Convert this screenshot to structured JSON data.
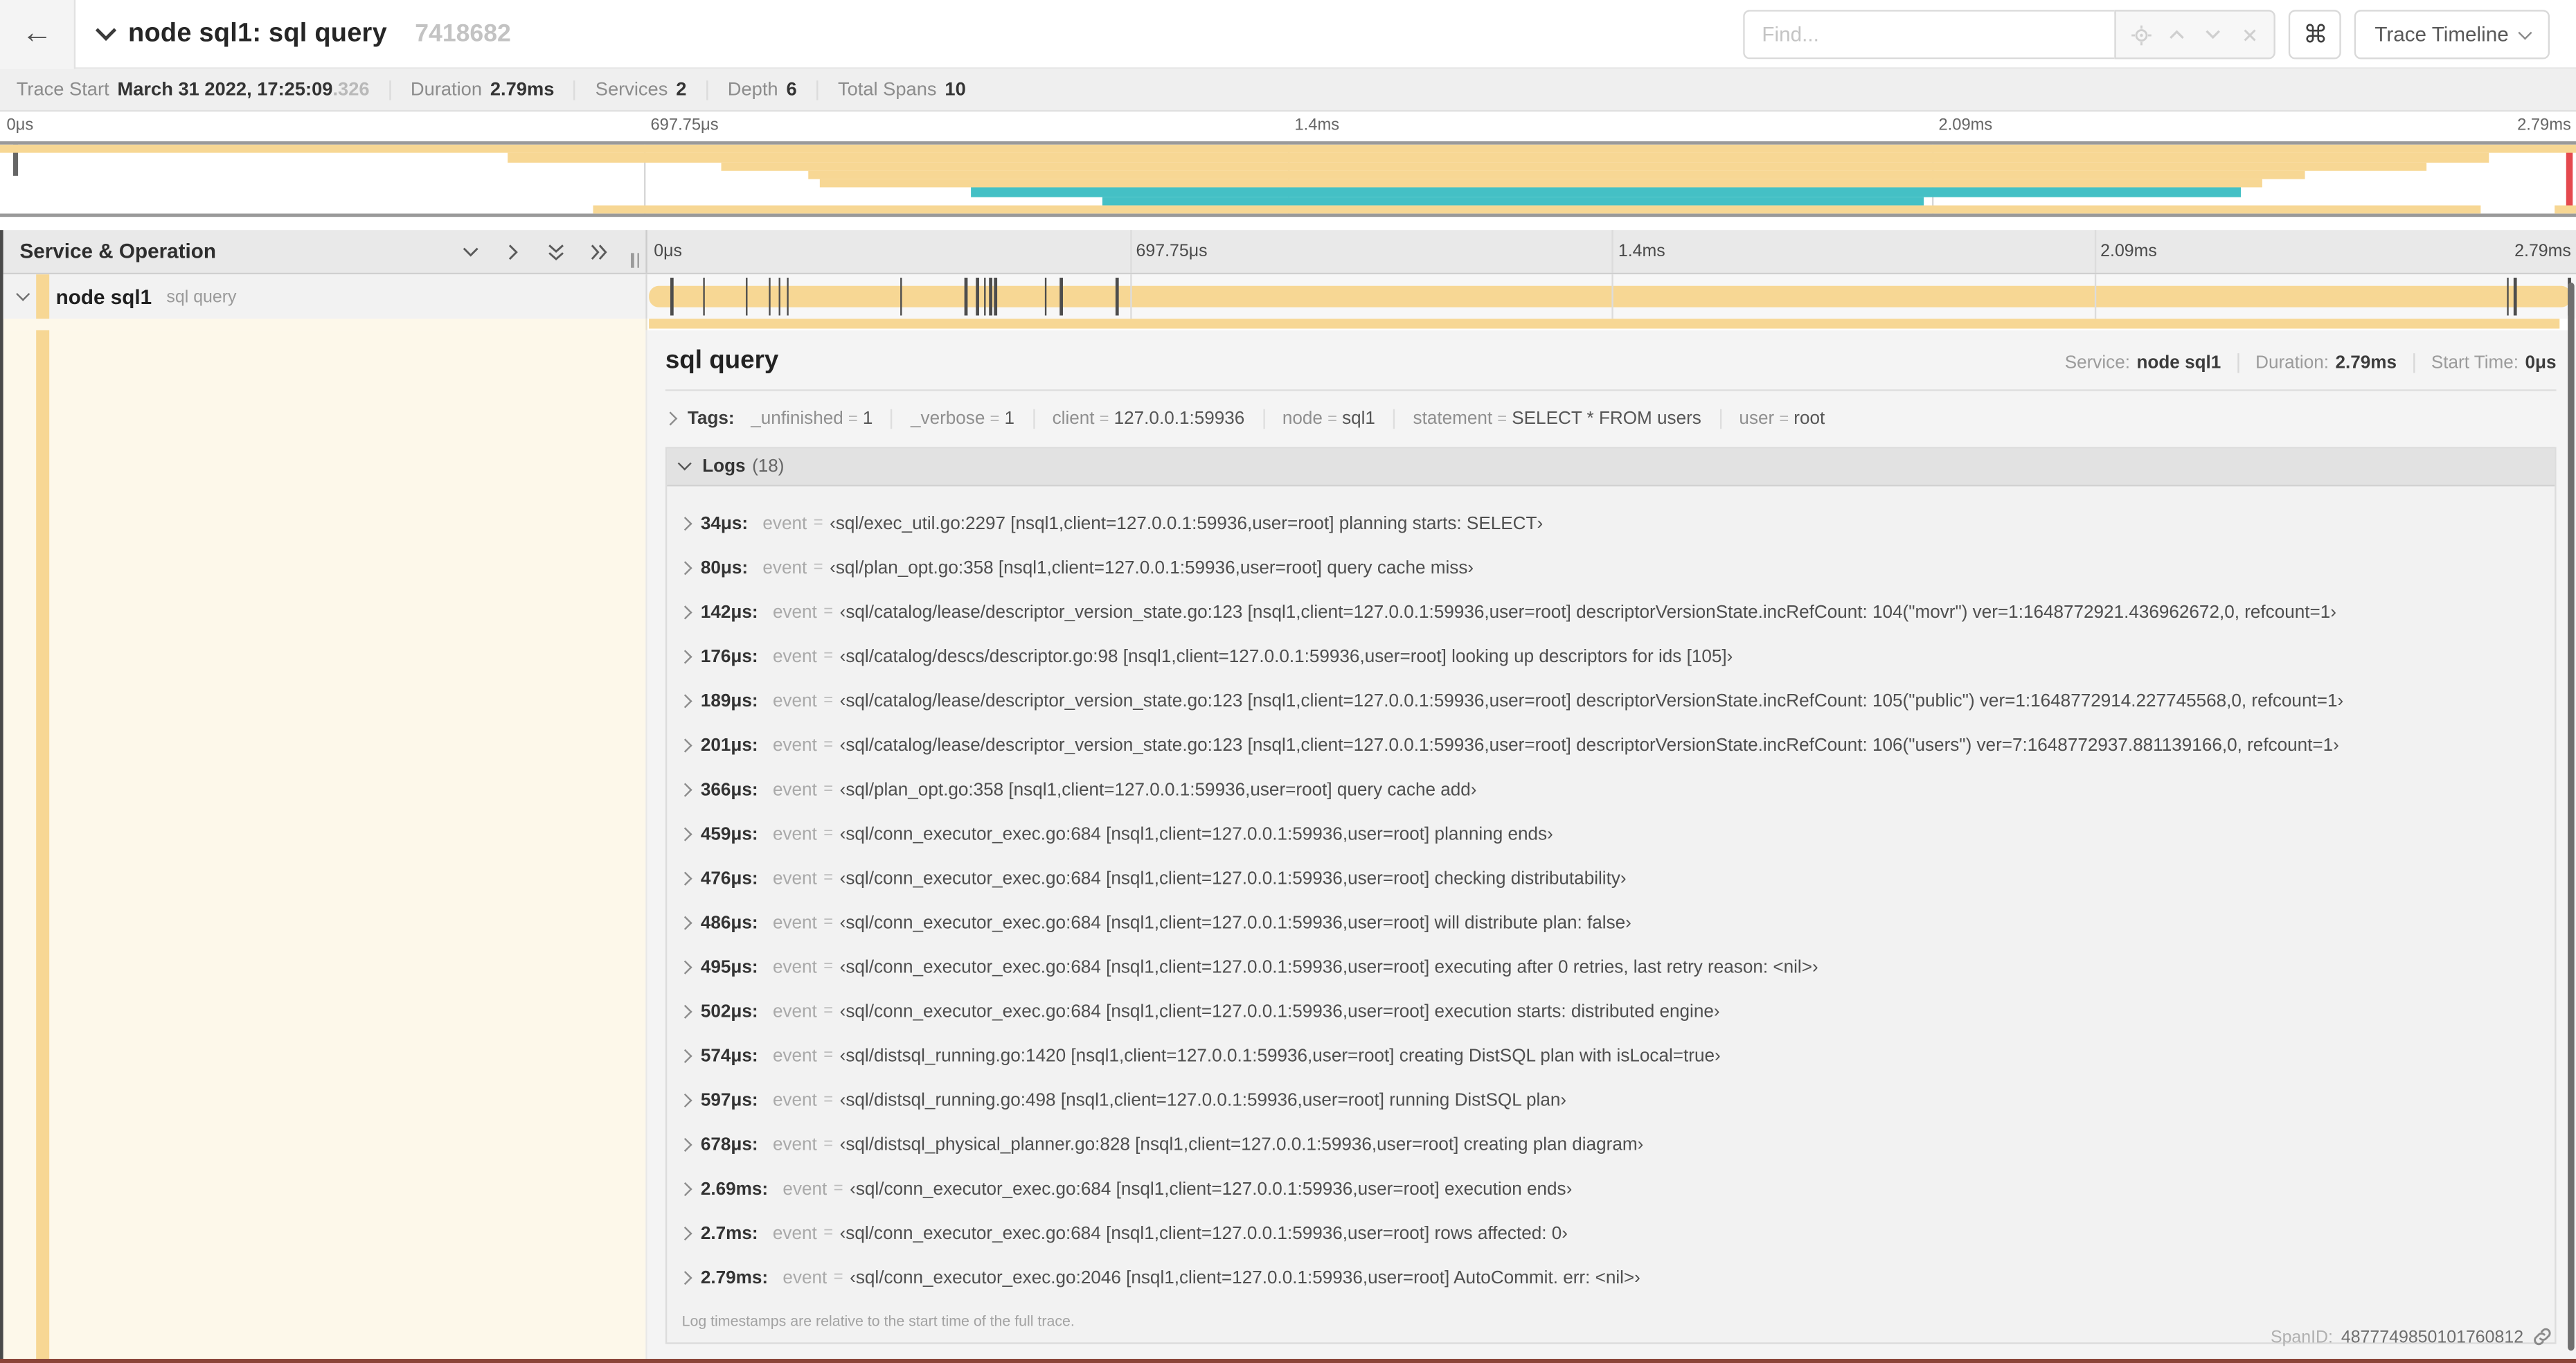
{
  "header": {
    "title": "node sql1: sql query",
    "trace_id": "7418682",
    "find_placeholder": "Find...",
    "view_selector": "Trace Timeline"
  },
  "trace_info": {
    "items": [
      {
        "label": "Trace Start",
        "value": "March 31 2022, 17:25:09",
        "value_muted": ".326"
      },
      {
        "label": "Duration",
        "value": "2.79ms"
      },
      {
        "label": "Services",
        "value": "2"
      },
      {
        "label": "Depth",
        "value": "6"
      },
      {
        "label": "Total Spans",
        "value": "10"
      }
    ]
  },
  "minimap": {
    "ticks": [
      "0μs",
      "697.75μs",
      "1.4ms",
      "2.09ms",
      "2.79ms"
    ],
    "colors": {
      "span": "#f7d794",
      "teal": "#44c0c5"
    },
    "bars": [
      {
        "row": 0,
        "start": 0,
        "end": 100,
        "color": "span"
      },
      {
        "row": 1,
        "start": 19.7,
        "end": 96.6,
        "color": "span"
      },
      {
        "row": 2,
        "start": 28.0,
        "end": 94.2,
        "color": "span"
      },
      {
        "row": 3,
        "start": 31.4,
        "end": 89.5,
        "color": "span"
      },
      {
        "row": 4,
        "start": 31.8,
        "end": 87.8,
        "color": "span"
      },
      {
        "row": 5,
        "start": 37.7,
        "end": 87.0,
        "color": "teal"
      },
      {
        "row": 6,
        "start": 42.8,
        "end": 74.7,
        "color": "teal"
      },
      {
        "row": 7,
        "start": 23.0,
        "end": 96.3,
        "color": "span"
      },
      {
        "row": 7,
        "start": 99.2,
        "end": 100,
        "color": "span"
      }
    ]
  },
  "timeline": {
    "column_header": "Service & Operation",
    "ticks": [
      "0μs",
      "697.75μs",
      "1.4ms",
      "2.09ms",
      "2.79ms"
    ]
  },
  "span_row": {
    "service": "node sql1",
    "operation": "sql query"
  },
  "detail": {
    "title": "sql query",
    "meta": [
      {
        "label": "Service:",
        "value": "node sql1"
      },
      {
        "label": "Duration:",
        "value": "2.79ms"
      },
      {
        "label": "Start Time:",
        "value": "0μs"
      }
    ],
    "tags_label": "Tags:",
    "tags": [
      {
        "key": "_unfinished",
        "value": "1"
      },
      {
        "key": "_verbose",
        "value": "1"
      },
      {
        "key": "client",
        "value": "127.0.0.1:59936"
      },
      {
        "key": "node",
        "value": "sql1"
      },
      {
        "key": "statement",
        "value": "SELECT * FROM users"
      },
      {
        "key": "user",
        "value": "root"
      }
    ],
    "logs_label": "Logs",
    "logs_count": "(18)",
    "logs": [
      {
        "time": "34μs",
        "field": "event",
        "value": "‹sql/exec_util.go:2297 [nsql1,client=127.0.0.1:59936,user=root] planning starts: SELECT›"
      },
      {
        "time": "80μs",
        "field": "event",
        "value": "‹sql/plan_opt.go:358 [nsql1,client=127.0.0.1:59936,user=root] query cache miss›"
      },
      {
        "time": "142μs",
        "field": "event",
        "value": "‹sql/catalog/lease/descriptor_version_state.go:123 [nsql1,client=127.0.0.1:59936,user=root] descriptorVersionState.incRefCount: 104(\"movr\") ver=1:1648772921.436962672,0, refcount=1›"
      },
      {
        "time": "176μs",
        "field": "event",
        "value": "‹sql/catalog/descs/descriptor.go:98 [nsql1,client=127.0.0.1:59936,user=root] looking up descriptors for ids [105]›"
      },
      {
        "time": "189μs",
        "field": "event",
        "value": "‹sql/catalog/lease/descriptor_version_state.go:123 [nsql1,client=127.0.0.1:59936,user=root] descriptorVersionState.incRefCount: 105(\"public\") ver=1:1648772914.227745568,0, refcount=1›"
      },
      {
        "time": "201μs",
        "field": "event",
        "value": "‹sql/catalog/lease/descriptor_version_state.go:123 [nsql1,client=127.0.0.1:59936,user=root] descriptorVersionState.incRefCount: 106(\"users\") ver=7:1648772937.881139166,0, refcount=1›"
      },
      {
        "time": "366μs",
        "field": "event",
        "value": "‹sql/plan_opt.go:358 [nsql1,client=127.0.0.1:59936,user=root] query cache add›"
      },
      {
        "time": "459μs",
        "field": "event",
        "value": "‹sql/conn_executor_exec.go:684 [nsql1,client=127.0.0.1:59936,user=root] planning ends›"
      },
      {
        "time": "476μs",
        "field": "event",
        "value": "‹sql/conn_executor_exec.go:684 [nsql1,client=127.0.0.1:59936,user=root] checking distributability›"
      },
      {
        "time": "486μs",
        "field": "event",
        "value": "‹sql/conn_executor_exec.go:684 [nsql1,client=127.0.0.1:59936,user=root] will distribute plan: false›"
      },
      {
        "time": "495μs",
        "field": "event",
        "value": "‹sql/conn_executor_exec.go:684 [nsql1,client=127.0.0.1:59936,user=root] executing after 0 retries, last retry reason: <nil>›"
      },
      {
        "time": "502μs",
        "field": "event",
        "value": "‹sql/conn_executor_exec.go:684 [nsql1,client=127.0.0.1:59936,user=root] execution starts: distributed engine›"
      },
      {
        "time": "574μs",
        "field": "event",
        "value": "‹sql/distsql_running.go:1420 [nsql1,client=127.0.0.1:59936,user=root] creating DistSQL plan with isLocal=true›"
      },
      {
        "time": "597μs",
        "field": "event",
        "value": "‹sql/distsql_running.go:498 [nsql1,client=127.0.0.1:59936,user=root] running DistSQL plan›"
      },
      {
        "time": "678μs",
        "field": "event",
        "value": "‹sql/distsql_physical_planner.go:828 [nsql1,client=127.0.0.1:59936,user=root] creating plan diagram›"
      },
      {
        "time": "2.69ms",
        "field": "event",
        "value": "‹sql/conn_executor_exec.go:684 [nsql1,client=127.0.0.1:59936,user=root] execution ends›"
      },
      {
        "time": "2.7ms",
        "field": "event",
        "value": "‹sql/conn_executor_exec.go:684 [nsql1,client=127.0.0.1:59936,user=root] rows affected: 0›"
      },
      {
        "time": "2.79ms",
        "field": "event",
        "value": "‹sql/conn_executor_exec.go:2046 [nsql1,client=127.0.0.1:59936,user=root] AutoCommit. err: <nil>›"
      }
    ],
    "logs_note": "Log timestamps are relative to the start time of the full trace.",
    "span_id_label": "SpanID:",
    "span_id": "4877749850101760812"
  }
}
